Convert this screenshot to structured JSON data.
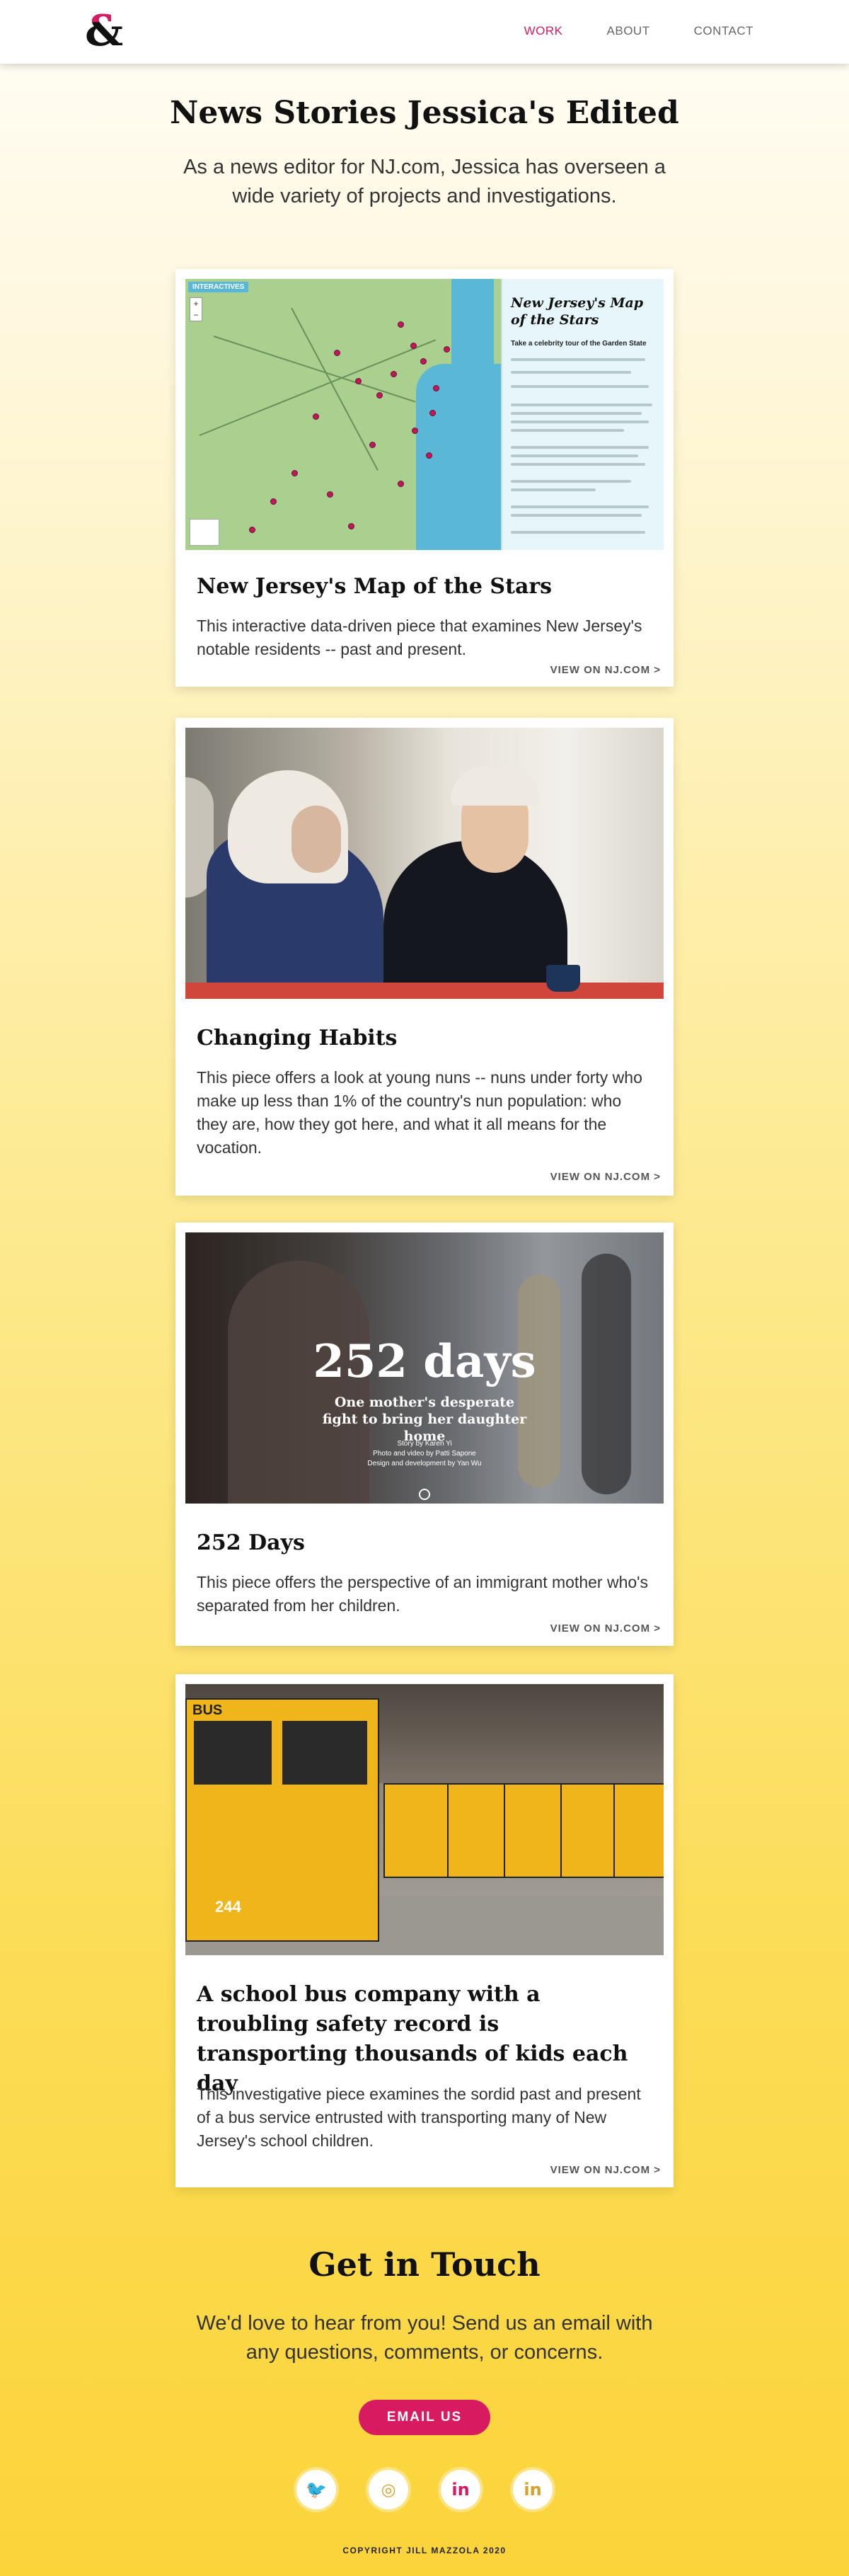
{
  "nav": {
    "logo": "&",
    "items": [
      {
        "label": "WORK",
        "active": true
      },
      {
        "label": "ABOUT",
        "active": false
      },
      {
        "label": "CONTACT",
        "active": false
      }
    ]
  },
  "page": {
    "title": "News Stories Jessica's Edited",
    "intro": "As a news editor for NJ.com, Jessica has overseen a wide variety of projects and investigations."
  },
  "stories": [
    {
      "title": "New Jersey's Map of the Stars",
      "description": "This interactive data-driven piece that examines New Jersey's notable residents -- past and present.",
      "link": "VIEW ON NJ.COM >",
      "thumb": {
        "tag": "INTERACTIVES",
        "map_title": "New Jersey's Map of the Stars",
        "map_sub": "Take a celebrity tour of the Garden State"
      }
    },
    {
      "title": "Changing Habits",
      "description": "This piece offers a look at young nuns -- nuns under forty who make up less than 1% of the country's nun population: who they are, how they got here, and what it all means for the vocation.",
      "link": "VIEW ON NJ.COM >"
    },
    {
      "title": "252 Days",
      "description": "This piece offers the perspective of an immigrant mother who's separated from her children.",
      "link": "VIEW ON NJ.COM >",
      "thumb": {
        "headline": "252 days",
        "subhead": "One mother's desperate fight to bring her daughter home",
        "credit1": "Story by Karen Yi",
        "credit2": "Photo and video by Patti Sapone",
        "credit3": "Design and development by Yan Wu"
      }
    },
    {
      "title": "A school bus company with a troubling safety record is transporting thousands of kids each day",
      "description": "This investigative piece examines the sordid past and present of a bus service entrusted with transporting many of New Jersey's school children.",
      "link": "VIEW ON NJ.COM >",
      "thumb": {
        "bus_label": "BUS",
        "bus_number": "244"
      }
    }
  ],
  "contact": {
    "title": "Get in Touch",
    "text": "We'd love to hear from you! Send us an email with any questions, comments, or concerns.",
    "button": "EMAIL US"
  },
  "social": [
    {
      "name": "twitter-icon",
      "glyph": "🐦",
      "color": "#d81b60"
    },
    {
      "name": "instagram-icon",
      "glyph": "◎",
      "color": "#d4a32a"
    },
    {
      "name": "linkedin-icon",
      "glyph": "in",
      "color": "#d81b60"
    },
    {
      "name": "linkedin-icon-2",
      "glyph": "in",
      "color": "#d4a32a"
    }
  ],
  "footer": {
    "copyright": "COPYRIGHT JILL MAZZOLA 2020"
  },
  "colors": {
    "accent": "#d81b60",
    "gold": "#d4a32a",
    "background_top": "#fffdf6",
    "background_bottom": "#fbd43a"
  }
}
